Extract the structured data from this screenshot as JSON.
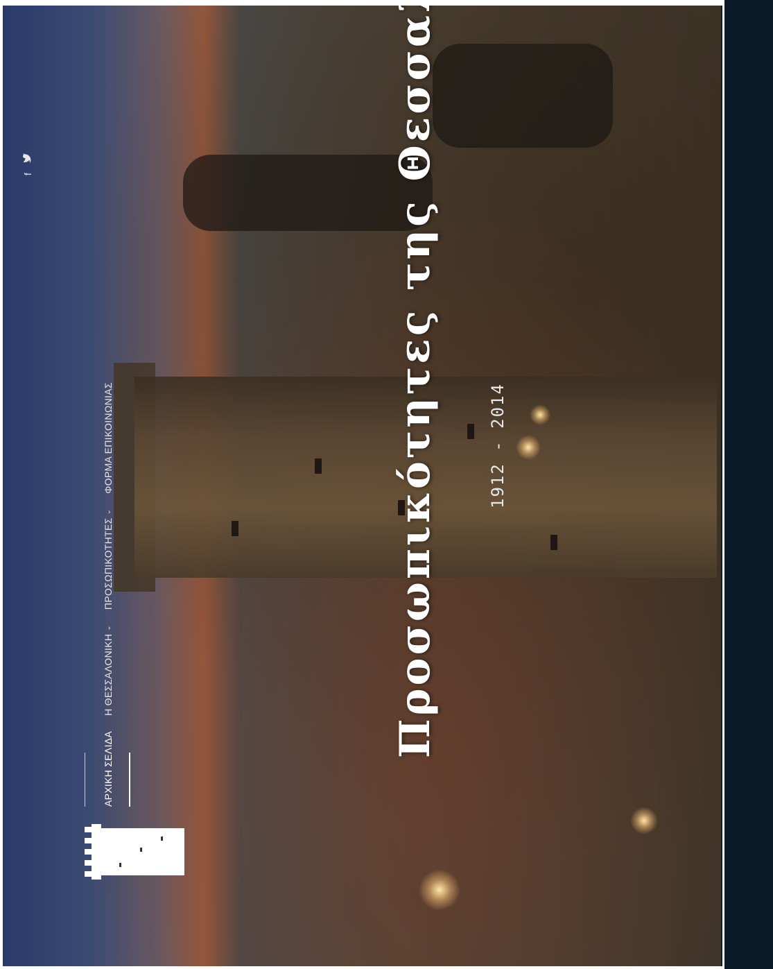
{
  "nav": {
    "items": [
      {
        "label": "ΑΡΧΙΚΗ ΣΕΛΙΔΑ",
        "active": true,
        "dropdown": false
      },
      {
        "label": "Η ΘΕΣΣΑΛΟΝΙΚΗ",
        "active": false,
        "dropdown": true
      },
      {
        "label": "ΠΡΟΣΩΠΙΚΟΤΗΤΕΣ",
        "active": false,
        "dropdown": true
      },
      {
        "label": "ΦΟΡΜΑ ΕΠΙΚΟΙΝΩΝΙΑΣ",
        "active": false,
        "dropdown": false
      }
    ]
  },
  "social": {
    "facebook": "f",
    "twitter": "🐦"
  },
  "hero": {
    "title": "Προσωπικότητες της Θεσσαλονίκης",
    "years": "1912 - 2014"
  },
  "icons": {
    "logo": "white-tower-logo-icon",
    "facebook": "facebook-icon",
    "twitter": "twitter-icon",
    "chevron": "chevron-down-icon"
  },
  "colors": {
    "nav_text": "#e6e6e6",
    "title": "#ffffff",
    "edge": "#0e1e2c"
  }
}
